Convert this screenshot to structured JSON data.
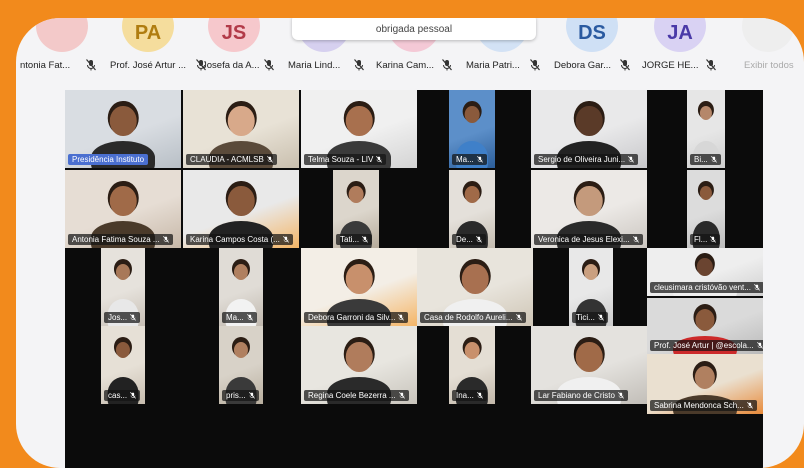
{
  "chat_bubble": "obrigada pessoal",
  "show_all": "Exibir todos",
  "avatars": [
    {
      "initials": "",
      "color": "#f3c9c9",
      "text_color": "#c24b4b"
    },
    {
      "initials": "PA",
      "color": "#f5dd9d",
      "text_color": "#b07d10"
    },
    {
      "initials": "JS",
      "color": "#f6c8cc",
      "text_color": "#b23a48"
    },
    {
      "initials": "",
      "color": "#d6d0ef",
      "text_color": "#5b4bb0"
    },
    {
      "initials": "",
      "color": "#f4c9d6",
      "text_color": "#b0385f"
    },
    {
      "initials": "",
      "color": "#d3e2f5",
      "text_color": "#2d5b9a"
    },
    {
      "initials": "DS",
      "color": "#cfe0f5",
      "text_color": "#2a5aa0"
    },
    {
      "initials": "JA",
      "color": "#d9d2f3",
      "text_color": "#4a3aa8"
    },
    {
      "initials": "",
      "color": "#eeeeee",
      "text_color": "#888888"
    }
  ],
  "participants": [
    "ntonia Fat...",
    "Prof. José Artur ...",
    "Josefa da A...",
    "Maria Lind...",
    "Karina Cam...",
    "Maria Patri...",
    "Debora Gar...",
    "JORGE HE..."
  ],
  "tiles": [
    "Presidência Instituto",
    "CLAUDIA - ACMLSB",
    "Telma Souza - LIV",
    "Ma...",
    "Sergio de Oliveira Juni...",
    "Bi...",
    "Antonia Fatima Souza ...",
    "Karina Campos Costa (...",
    "Tati...",
    "De...",
    "Veronica de Jesus Elexi...",
    "Fl...",
    "cleusimara cristóvão vent...",
    "Jos...",
    "Ma...",
    "Debora Garroni da Silv...",
    "Casa de Rodolfo Aureli...",
    "Tici...",
    "Prof. José Artur | @escola...",
    "cas...",
    "pris...",
    "Regina Coele Bezerra ...",
    "Ina...",
    "Lar Fabiano de Cristo",
    "Sabrina Mendonca Sch..."
  ]
}
